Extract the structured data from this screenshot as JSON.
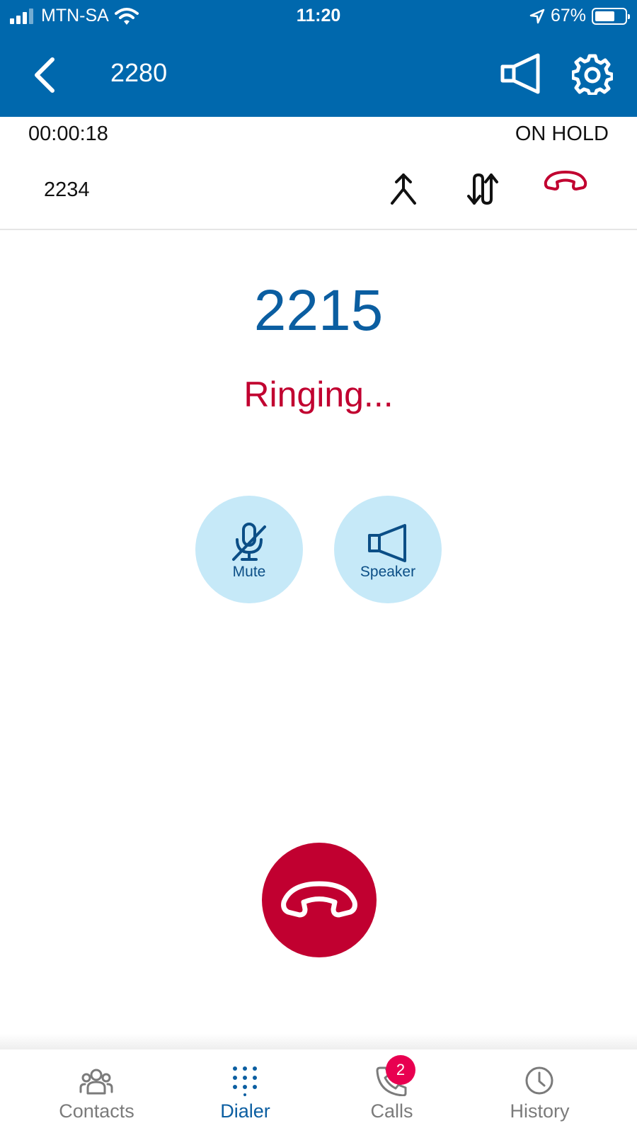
{
  "status_bar": {
    "carrier": "MTN-SA",
    "time": "11:20",
    "battery_percent": "67%",
    "battery_level": 0.67
  },
  "header": {
    "title": "2280"
  },
  "held_call": {
    "timer": "00:00:18",
    "status": "ON HOLD",
    "number": "2234"
  },
  "active_call": {
    "number": "2215",
    "status": "Ringing..."
  },
  "controls": {
    "mute_label": "Mute",
    "speaker_label": "Speaker"
  },
  "bottom_nav": {
    "items": [
      {
        "label": "Contacts",
        "icon": "contacts-icon"
      },
      {
        "label": "Dialer",
        "icon": "dialpad-icon",
        "active": true
      },
      {
        "label": "Calls",
        "icon": "phone-icon",
        "badge": "2"
      },
      {
        "label": "History",
        "icon": "clock-icon"
      }
    ]
  },
  "colors": {
    "header_bg": "#0068ad",
    "accent_blue": "#0b5ea1",
    "end_call_red": "#c10030",
    "control_bg": "#c6e9f8",
    "badge": "#e80050"
  }
}
